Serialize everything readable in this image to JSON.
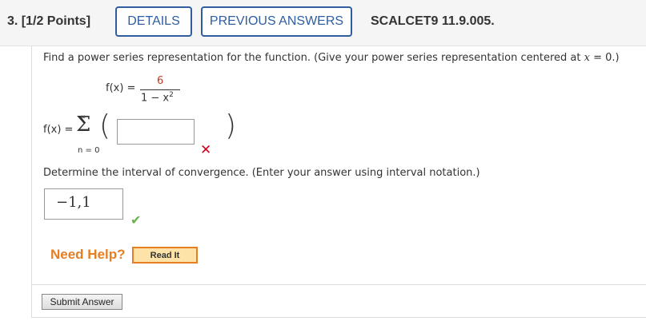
{
  "header": {
    "question": "3. [1/2 Points]",
    "details_label": "DETAILS",
    "previous_answers_label": "PREVIOUS ANSWERS",
    "problem_code": "SCALCET9 11.9.005."
  },
  "part1": {
    "prompt_start": "Find a power series representation for the function. (Give your power series representation centered at ",
    "prompt_var": "x",
    "prompt_end": " = 0.)",
    "function_lhs": "f(x) =",
    "numerator": "6",
    "denominator": "1 − x",
    "denominator_exp": "2",
    "series_lhs": "f(x) =",
    "sum_upper": "∞",
    "sum_lower": "n = 0",
    "answer_value": "",
    "status": "incorrect"
  },
  "part2": {
    "prompt": "Determine the interval of convergence. (Enter your answer using interval notation.)",
    "answer_value": "−1,1",
    "status": "correct"
  },
  "help": {
    "need_help_label": "Need Help?",
    "read_it_label": "Read It"
  },
  "submit_label": "Submit Answer",
  "colors": {
    "accent": "#2f5da0",
    "incorrect": "#d0021b",
    "correct": "#6ab04c",
    "help": "#e67e22"
  }
}
